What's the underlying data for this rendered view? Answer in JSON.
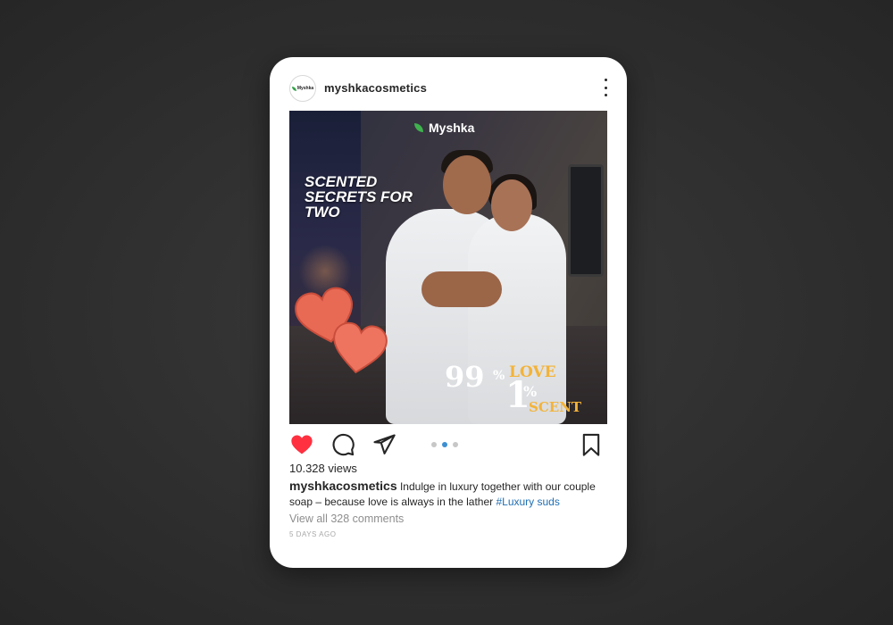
{
  "post": {
    "username": "myshkacosmetics",
    "avatar_text": "Myshka",
    "image": {
      "brand": "Myshka",
      "tagline": "Scented Secrets for Two",
      "heart_stamp": "Heart Suds",
      "promo_num_99": "99",
      "promo_pct_1": "%",
      "promo_love": "LOVE",
      "promo_num_1": "1",
      "promo_pct_2": "%",
      "promo_scent": "SCENT"
    },
    "views": "10.328 views",
    "caption_user": "myshkacosmetics",
    "caption_text": " Indulge in luxury together with our couple soap – because love is always in the lather ",
    "hashtag": "#Luxury suds",
    "comments_link": "View all 328 comments",
    "timestamp": "5 DAYS AGO",
    "carousel": {
      "count": 3,
      "active": 2
    }
  },
  "icons": {
    "more": "more-vertical-icon",
    "like": "heart-filled-icon",
    "comment": "comment-icon",
    "share": "paper-plane-icon",
    "save": "bookmark-icon"
  },
  "colors": {
    "like": "#ff3040",
    "hashtag": "#1f6fb3",
    "carousel_active": "#3d8fd1",
    "brand_leaf": "#3fb24e",
    "promo_accent": "#f3b338"
  }
}
